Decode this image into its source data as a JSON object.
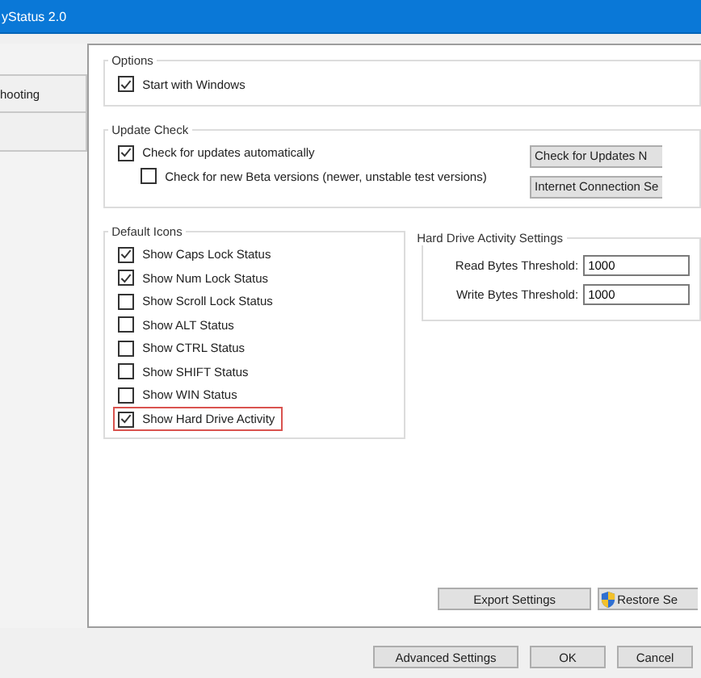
{
  "window": {
    "title": "yStatus 2.0"
  },
  "sidebar": {
    "tabs": [
      {
        "label": "hooting"
      }
    ]
  },
  "options": {
    "title": "Options",
    "items": [
      {
        "label": "Start with Windows",
        "checked": true
      }
    ]
  },
  "update_check": {
    "title": "Update Check",
    "items": [
      {
        "label": "Check for updates automatically",
        "checked": true,
        "indented": false
      },
      {
        "label": "Check for new Beta versions (newer, unstable test versions)",
        "checked": false,
        "indented": true
      }
    ],
    "buttons": [
      {
        "label": "Check for Updates N"
      },
      {
        "label": "Internet Connection Se"
      }
    ]
  },
  "default_icons": {
    "title": "Default Icons",
    "items": [
      {
        "label": "Show Caps Lock Status",
        "checked": true,
        "highlighted": false
      },
      {
        "label": "Show Num Lock Status",
        "checked": true,
        "highlighted": false
      },
      {
        "label": "Show Scroll Lock Status",
        "checked": false,
        "highlighted": false
      },
      {
        "label": "Show ALT Status",
        "checked": false,
        "highlighted": false
      },
      {
        "label": "Show CTRL Status",
        "checked": false,
        "highlighted": false
      },
      {
        "label": "Show SHIFT Status",
        "checked": false,
        "highlighted": false
      },
      {
        "label": "Show WIN Status",
        "checked": false,
        "highlighted": false
      },
      {
        "label": "Show Hard Drive Activity",
        "checked": true,
        "highlighted": true
      }
    ]
  },
  "hard_drive": {
    "title": "Hard Drive Activity Settings",
    "fields": [
      {
        "label": "Read Bytes Threshold:",
        "value": "1000"
      },
      {
        "label": "Write Bytes Threshold:",
        "value": "1000"
      }
    ]
  },
  "panel_buttons": [
    {
      "label": "Export Settings",
      "shield": false
    },
    {
      "label": "Restore Se",
      "shield": true
    }
  ],
  "footer_buttons": [
    {
      "label": "Advanced Settings"
    },
    {
      "label": "OK"
    },
    {
      "label": "Cancel"
    }
  ]
}
